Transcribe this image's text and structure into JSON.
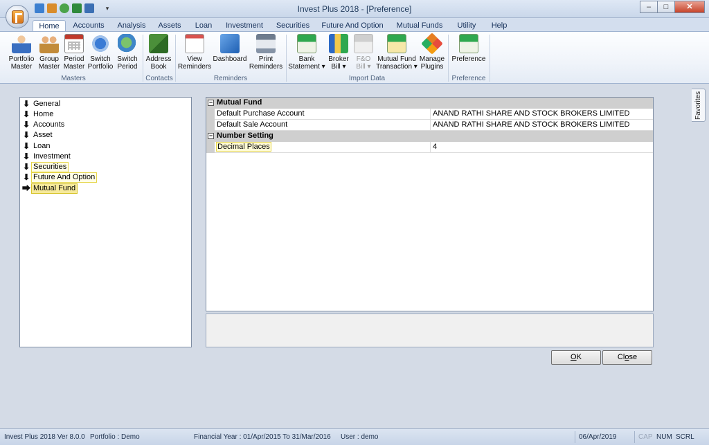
{
  "window": {
    "title": "Invest Plus 2018 - [Preference]",
    "min_glyph": "‒",
    "max_glyph": "□",
    "close_glyph": "✕"
  },
  "quick_access": {
    "dropdown_glyph": "▾"
  },
  "ribbon_tabs": [
    "Home",
    "Accounts",
    "Analysis",
    "Assets",
    "Loan",
    "Investment",
    "Securities",
    "Future And Option",
    "Mutual Funds",
    "Utility",
    "Help"
  ],
  "active_tab": "Home",
  "ribbon": {
    "masters": {
      "label": "Masters",
      "buttons": [
        {
          "line1": "Portfolio",
          "line2": "Master",
          "icon": "portfolio-master-icon"
        },
        {
          "line1": "Group",
          "line2": "Master",
          "icon": "group-master-icon"
        },
        {
          "line1": "Period",
          "line2": "Master",
          "icon": "period-master-icon"
        },
        {
          "line1": "Switch",
          "line2": "Portfolio",
          "icon": "switch-portfolio-icon"
        },
        {
          "line1": "Switch",
          "line2": "Period",
          "icon": "switch-period-icon"
        }
      ]
    },
    "contacts": {
      "label": "Contacts",
      "buttons": [
        {
          "line1": "Address",
          "line2": "Book",
          "icon": "address-book-icon"
        }
      ]
    },
    "reminders": {
      "label": "Reminders",
      "buttons": [
        {
          "line1": "View",
          "line2": "Reminders",
          "icon": "view-reminders-icon"
        },
        {
          "line1": "Dashboard",
          "line2": "",
          "icon": "dashboard-icon"
        },
        {
          "line1": "Print",
          "line2": "Reminders",
          "icon": "print-reminders-icon"
        }
      ]
    },
    "import_data": {
      "label": "Import Data",
      "buttons": [
        {
          "line1": "Bank",
          "line2": "Statement ▾",
          "icon": "bank-statement-icon"
        },
        {
          "line1": "Broker",
          "line2": "Bill ▾",
          "icon": "broker-bill-icon"
        },
        {
          "line1": "F&O",
          "line2": "Bill ▾",
          "icon": "fo-bill-icon",
          "disabled": true
        },
        {
          "line1": "Mutual Fund",
          "line2": "Transaction ▾",
          "icon": "mutual-fund-transaction-icon"
        },
        {
          "line1": "Manage",
          "line2": "Plugins",
          "icon": "manage-plugins-icon"
        }
      ]
    },
    "preference": {
      "label": "Preference",
      "buttons": [
        {
          "line1": "Preference",
          "line2": "",
          "icon": "preference-icon"
        }
      ]
    }
  },
  "favorites_tab": "Favorites",
  "tree": {
    "arrow_glyph": "⬇",
    "selected_arrow_glyph": "⮕",
    "items": [
      "General",
      "Home",
      "Accounts",
      "Asset",
      "Loan",
      "Investment",
      "Securities",
      "Future And Option",
      "Mutual Fund"
    ],
    "selected": "Mutual Fund"
  },
  "property_grid": {
    "toggle_glyph": "−",
    "categories": [
      {
        "name": "Mutual Fund",
        "rows": [
          {
            "name": "Default Purchase Account",
            "value": "ANAND RATHI SHARE AND STOCK BROKERS LIMITED"
          },
          {
            "name": "Default Sale Account",
            "value": "ANAND RATHI SHARE AND STOCK BROKERS LIMITED"
          }
        ]
      },
      {
        "name": "Number Setting",
        "rows": [
          {
            "name": "Decimal Places",
            "value": "4"
          }
        ]
      }
    ]
  },
  "buttons": {
    "ok_accel": "O",
    "ok_rest": "K",
    "close_pre": "Cl",
    "close_accel": "o",
    "close_rest": "se"
  },
  "statusbar": {
    "version": "Invest Plus 2018 Ver 8.0.0",
    "portfolio": "Portfolio : Demo",
    "financial_year": "Financial Year : 01/Apr/2015 To 31/Mar/2016",
    "user": "User : demo",
    "date": "06/Apr/2019",
    "cap": "CAP",
    "num": "NUM",
    "scrl": "SCRL"
  }
}
